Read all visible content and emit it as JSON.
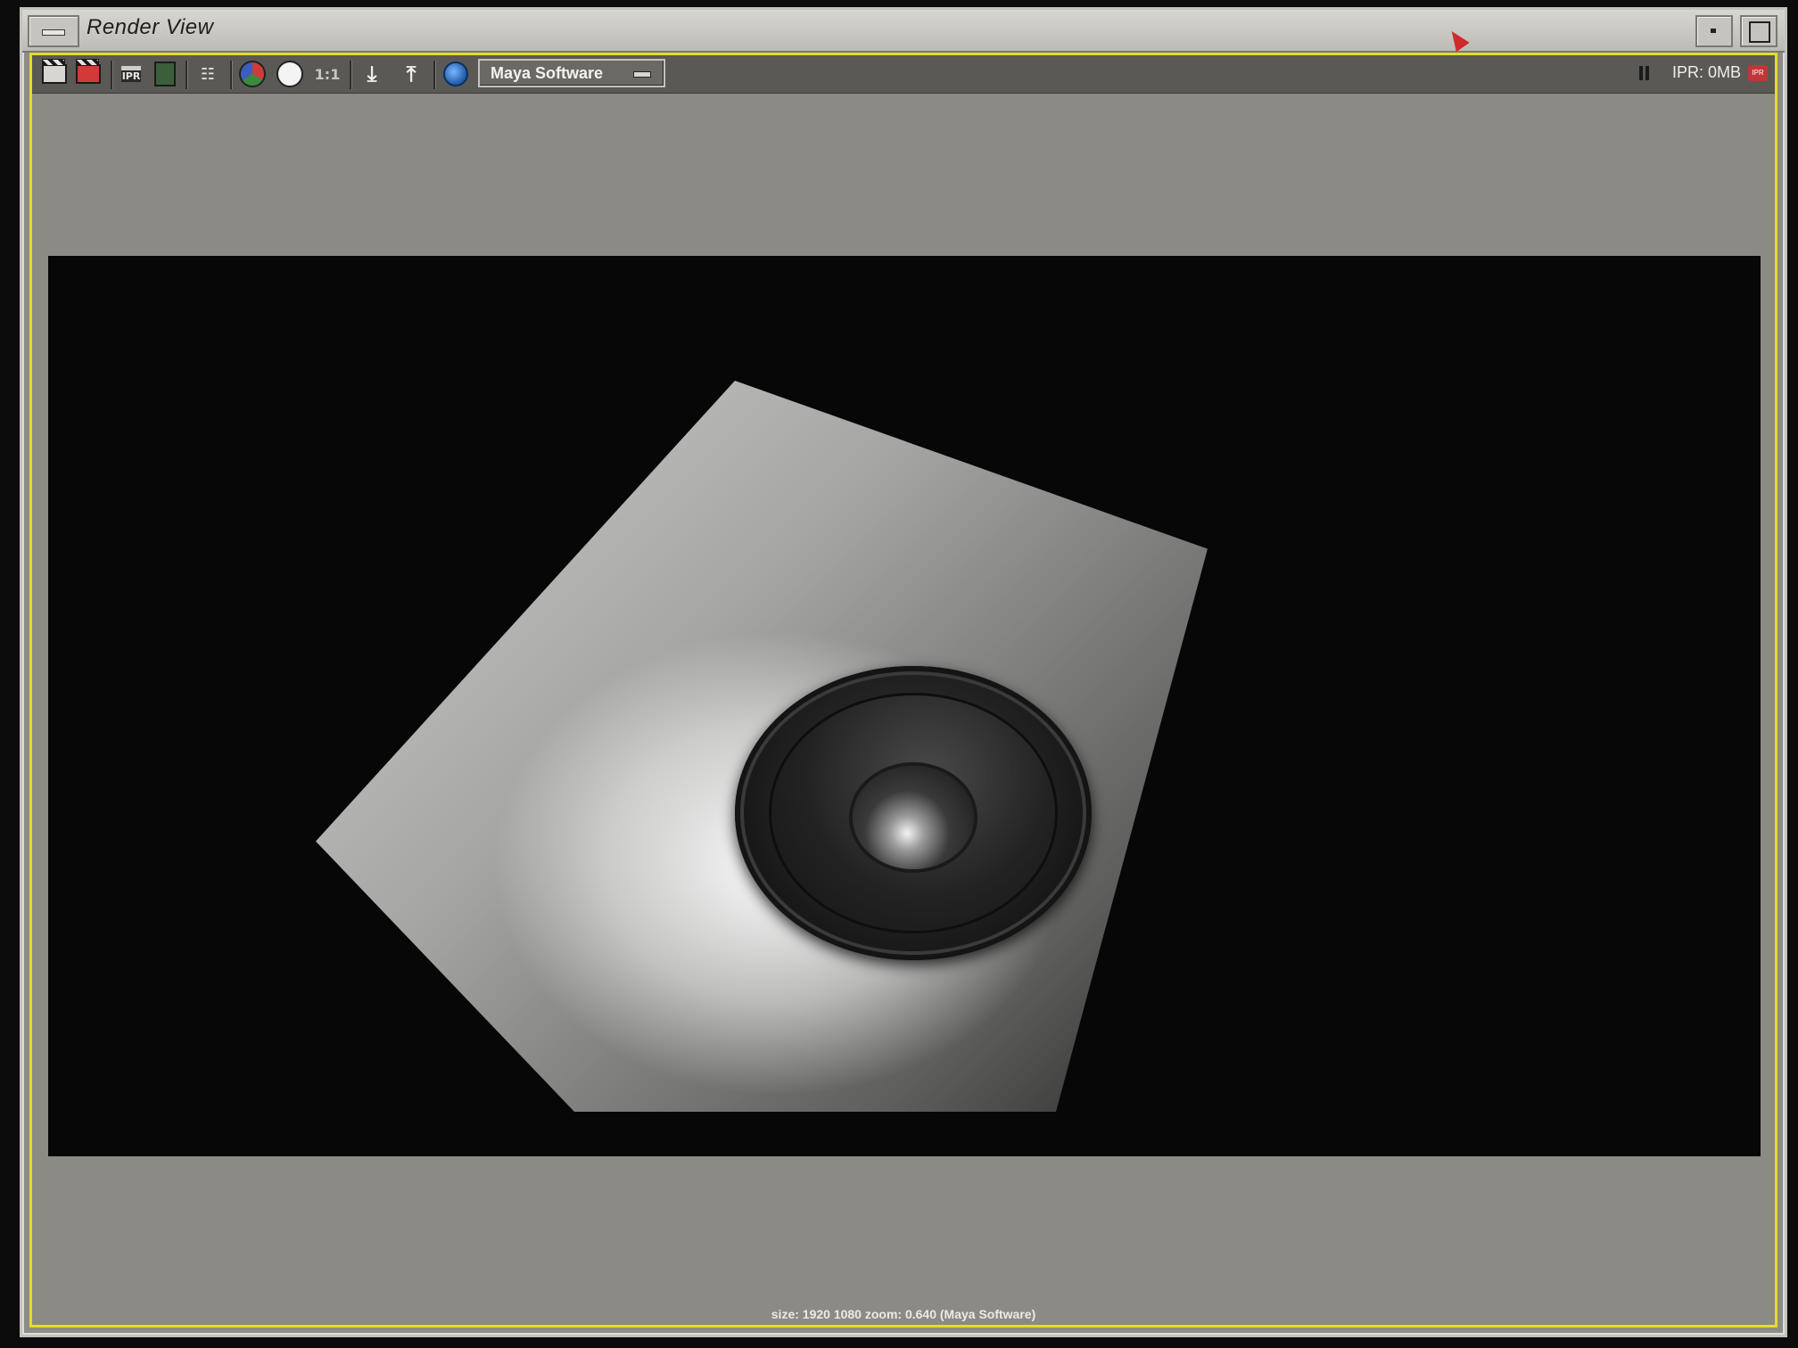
{
  "window": {
    "title": "Render View"
  },
  "toolbar": {
    "icons": [
      {
        "name": "redo-render-icon"
      },
      {
        "name": "render-region-icon"
      },
      {
        "name": "ipr-render-icon",
        "text": "IPR"
      },
      {
        "name": "snapshot-icon"
      },
      {
        "name": "render-settings-icon"
      },
      {
        "name": "display-rgb-icon"
      },
      {
        "name": "display-alpha-icon"
      },
      {
        "name": "real-size-icon",
        "text": "1:1"
      },
      {
        "name": "keep-image-icon"
      },
      {
        "name": "remove-image-icon"
      },
      {
        "name": "hypershade-icon"
      }
    ],
    "renderer": "Maya Software",
    "ipr_status": "IPR: 0MB",
    "ipr_badge": "IPR"
  },
  "status": {
    "text": "size: 1920 1080 zoom: 0.640  (Maya Software)"
  },
  "colors": {
    "panel_border": "#e4dc2a",
    "toolbar_bg": "#5a5955",
    "panel_bg": "#8c8a84",
    "cursor": "#d02a2a"
  }
}
